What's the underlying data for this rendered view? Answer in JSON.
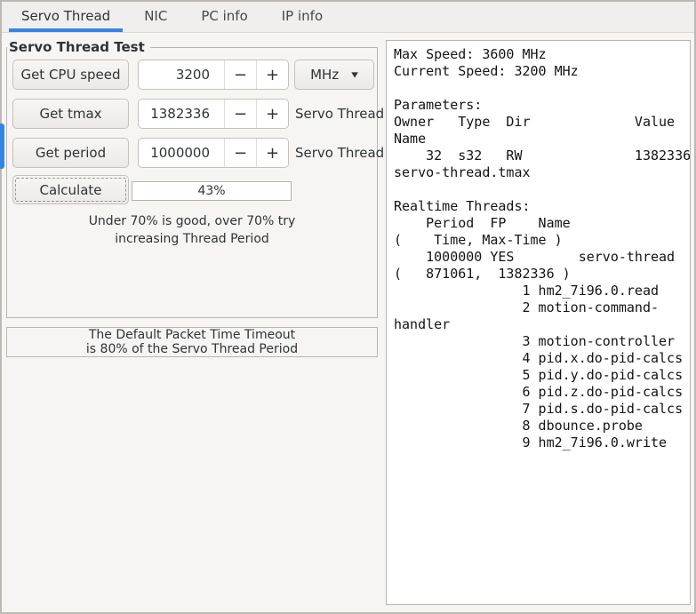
{
  "tabs": [
    {
      "label": "Servo Thread"
    },
    {
      "label": "NIC"
    },
    {
      "label": "PC info"
    },
    {
      "label": "IP info"
    }
  ],
  "frame": {
    "title": "Servo Thread Test"
  },
  "rows": [
    {
      "button": "Get CPU speed",
      "value": "3200"
    },
    {
      "button": "Get tmax",
      "value": "1382336",
      "label": "Servo Thread"
    },
    {
      "button": "Get period",
      "value": "1000000",
      "label": "Servo Thread"
    }
  ],
  "unit_combo": {
    "value": "MHz"
  },
  "calc": {
    "button": "Calculate",
    "progress": "43%"
  },
  "hint": {
    "line1": "Under 70% is good, over 70% try",
    "line2": "increasing Thread Period"
  },
  "timeout_note": {
    "line1": "The Default Packet Time Timeout",
    "line2": "is 80% of the Servo Thread Period"
  },
  "output": {
    "text": "Max Speed: 3600 MHz\nCurrent Speed: 3200 MHz\n\nParameters:\nOwner   Type  Dir             Value\nName\n    32  s32   RW              1382336\nservo-thread.tmax\n\nRealtime Threads:\n    Period  FP    Name\n(    Time, Max-Time )\n    1000000 YES        servo-thread\n(   871061,  1382336 )\n                1 hm2_7i96.0.read\n                2 motion-command-\nhandler\n                3 motion-controller\n                4 pid.x.do-pid-calcs\n                5 pid.y.do-pid-calcs\n                6 pid.z.do-pid-calcs\n                7 pid.s.do-pid-calcs\n                8 dbounce.probe\n                9 hm2_7i96.0.write"
  },
  "icons": {
    "minus": "−",
    "plus": "+",
    "dropdown_arrow": "▼"
  },
  "colors": {
    "accent": "#3584e4"
  }
}
